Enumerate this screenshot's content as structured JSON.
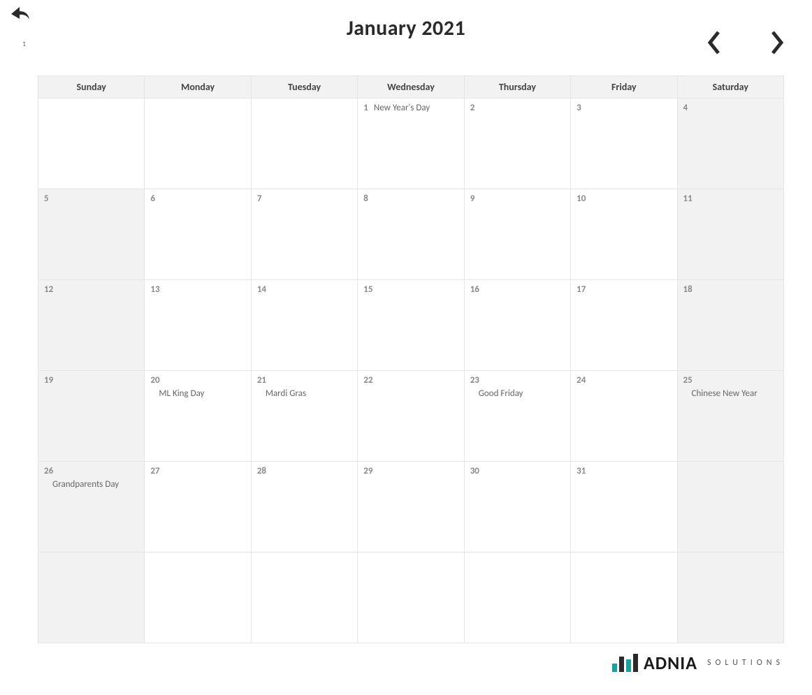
{
  "header": {
    "title": "January  2021",
    "small_number": "1"
  },
  "weekdays": [
    "Sunday",
    "Monday",
    "Tuesday",
    "Wednesday",
    "Thursday",
    "Friday",
    "Saturday"
  ],
  "weeks": [
    [
      {
        "day": "",
        "event": "",
        "weekend": true
      },
      {
        "day": "",
        "event": "",
        "weekend": false
      },
      {
        "day": "",
        "event": "",
        "weekend": false
      },
      {
        "day": "",
        "event": "",
        "weekend": false
      },
      {
        "day": "1",
        "event": "New Year's Day",
        "weekend": false,
        "inline": true
      },
      {
        "day": "2",
        "event": "",
        "weekend": false
      },
      {
        "day": "3",
        "event": "",
        "weekend": false
      },
      {
        "day": "4",
        "event": "",
        "weekend": true
      }
    ],
    [
      {
        "day": "5",
        "event": "",
        "weekend": true
      },
      {
        "day": "6",
        "event": "",
        "weekend": false
      },
      {
        "day": "7",
        "event": "",
        "weekend": false
      },
      {
        "day": "8",
        "event": "",
        "weekend": false
      },
      {
        "day": "9",
        "event": "",
        "weekend": false
      },
      {
        "day": "10",
        "event": "",
        "weekend": false
      },
      {
        "day": "11",
        "event": "",
        "weekend": true
      }
    ],
    [
      {
        "day": "12",
        "event": "",
        "weekend": true
      },
      {
        "day": "13",
        "event": "",
        "weekend": false
      },
      {
        "day": "14",
        "event": "",
        "weekend": false
      },
      {
        "day": "15",
        "event": "",
        "weekend": false
      },
      {
        "day": "16",
        "event": "",
        "weekend": false
      },
      {
        "day": "17",
        "event": "",
        "weekend": false
      },
      {
        "day": "18",
        "event": "",
        "weekend": true
      }
    ],
    [
      {
        "day": "19",
        "event": "",
        "weekend": true
      },
      {
        "day": "20",
        "event": "ML King Day",
        "weekend": false
      },
      {
        "day": "21",
        "event": "Mardi Gras",
        "weekend": false
      },
      {
        "day": "22",
        "event": "",
        "weekend": false
      },
      {
        "day": "23",
        "event": "Good Friday",
        "weekend": false
      },
      {
        "day": "24",
        "event": "",
        "weekend": false
      },
      {
        "day": "25",
        "event": "Chinese New  Year",
        "weekend": true
      }
    ],
    [
      {
        "day": "26",
        "event": "Grandparents Day",
        "weekend": true
      },
      {
        "day": "27",
        "event": "",
        "weekend": false
      },
      {
        "day": "28",
        "event": "",
        "weekend": false
      },
      {
        "day": "29",
        "event": "",
        "weekend": false
      },
      {
        "day": "30",
        "event": "",
        "weekend": false
      },
      {
        "day": "31",
        "event": "",
        "weekend": false
      },
      {
        "day": "",
        "event": "",
        "weekend": true
      }
    ],
    [
      {
        "day": "",
        "event": "",
        "weekend": true
      },
      {
        "day": "",
        "event": "",
        "weekend": false
      },
      {
        "day": "",
        "event": "",
        "weekend": false
      },
      {
        "day": "",
        "event": "",
        "weekend": false
      },
      {
        "day": "",
        "event": "",
        "weekend": false
      },
      {
        "day": "",
        "event": "",
        "weekend": false
      },
      {
        "day": "",
        "event": "",
        "weekend": true
      }
    ]
  ],
  "footer": {
    "brand": "ADNIA",
    "brand_sub": "SOLUTIONS"
  }
}
